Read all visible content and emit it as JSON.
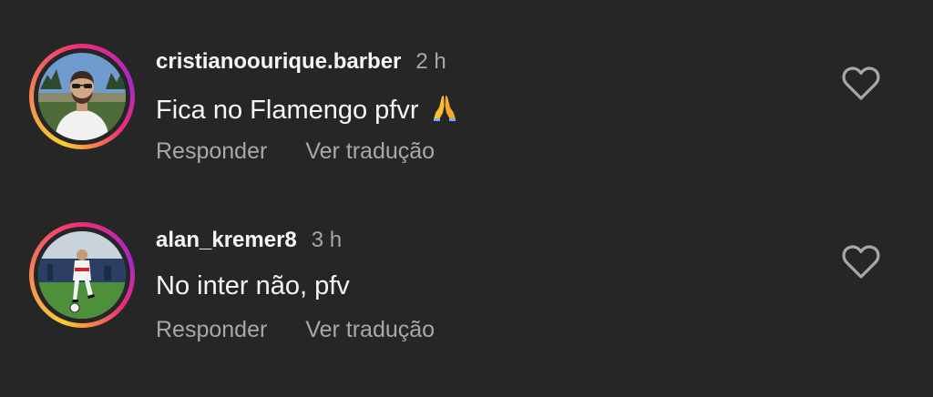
{
  "comments": [
    {
      "username": "cristianoourique.barber",
      "time": "2 h",
      "text": "Fica no Flamengo pfvr",
      "emoji": "folded-hands-icon",
      "reply_label": "Responder",
      "translate_label": "Ver tradução"
    },
    {
      "username": "alan_kremer8",
      "time": "3 h",
      "text": "No inter não, pfv",
      "reply_label": "Responder",
      "translate_label": "Ver tradução"
    }
  ],
  "colors": {
    "background": "#262626",
    "primary_text": "#f5f5f5",
    "secondary_text": "#a8a8a8",
    "story_ring": [
      "#f9ce34",
      "#ee2a7b",
      "#a629c9"
    ]
  },
  "icons": [
    "heart-outline-icon",
    "folded-hands-icon"
  ]
}
